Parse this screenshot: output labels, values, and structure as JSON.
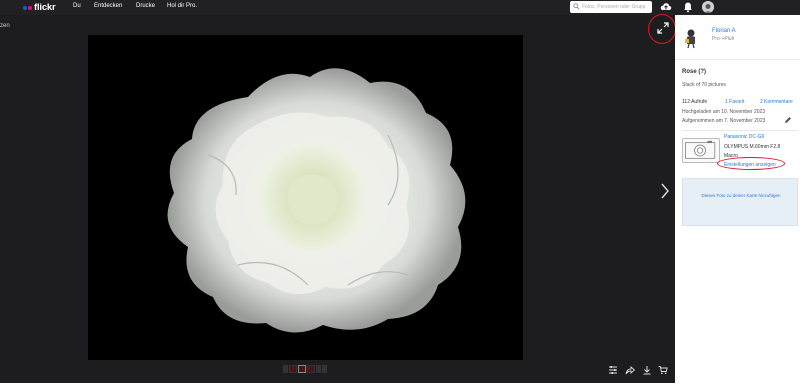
{
  "header": {
    "logo_text": "flickr",
    "nav": [
      {
        "label": "Du"
      },
      {
        "label": "Entdecken"
      },
      {
        "label": "Drucke"
      },
      {
        "label": "Hol dir Pro."
      }
    ],
    "search_placeholder": "Fotos, Personen oder Grupp"
  },
  "viewer": {
    "back_label": "zen"
  },
  "owner": {
    "name": "Florian A",
    "status": "Pro·+Pluh"
  },
  "photo_info": {
    "title": "Rose (?)",
    "description": "Stack of 70 pictures",
    "views": "112 Aufrufe",
    "faves": "1 Favorit",
    "comments": "2 Kommentare",
    "uploaded": "Hochgeladen am 10. November 2023",
    "taken": "Aufgenommen am 7. November 2023"
  },
  "camera": {
    "model": "Panasonic DC-G9",
    "lens": "OLYMPUS M.60mm F2.8",
    "lens_type": "Macro",
    "settings_link": "Einstellungen anzeigen"
  },
  "map": {
    "add_text": "Dieses Foto zu deiner Karte hinzufügen"
  },
  "colors": {
    "topbar": "#212124",
    "viewer_bg": "#1d1d1f",
    "link": "#2b7bd1",
    "annotation_red": "#e0161d",
    "logo_blue": "#0063dc",
    "logo_pink": "#ff0084"
  }
}
